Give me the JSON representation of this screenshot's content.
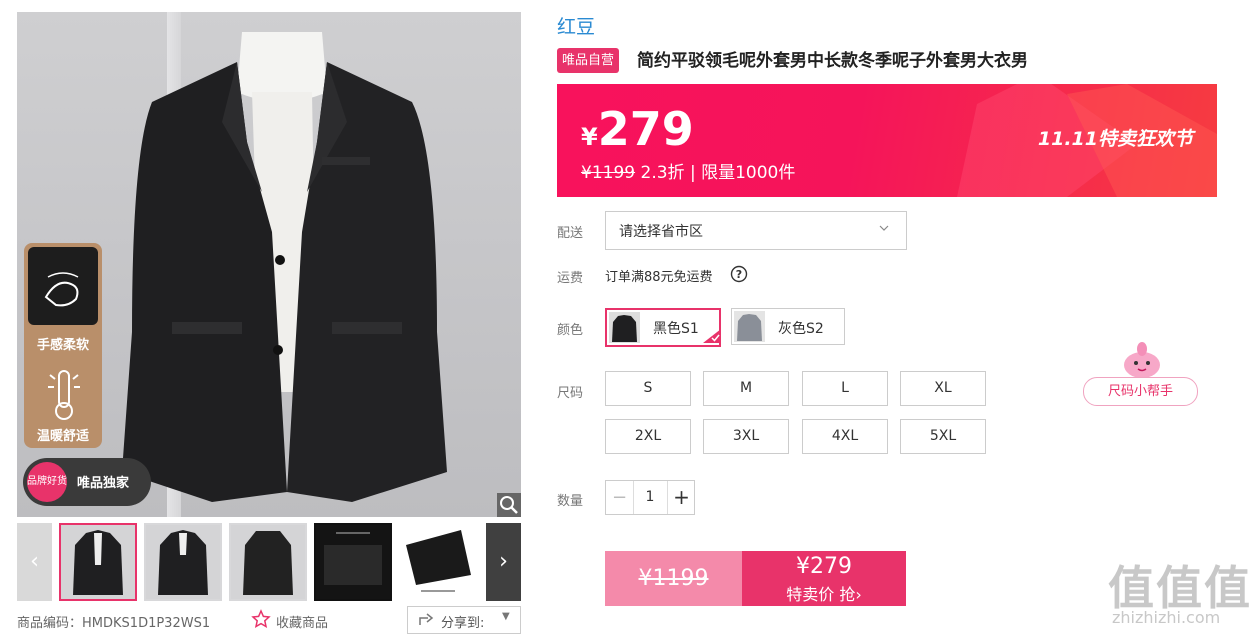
{
  "gallery": {
    "features": [
      "手感柔软",
      "温暖舒适"
    ],
    "brand_badge": {
      "circle_text": "品牌好货",
      "label": "唯品独家"
    },
    "thumb_count": 6
  },
  "product": {
    "brand": "红豆",
    "tag": "唯品自营",
    "title": "简约平驳领毛呢外套男中长款冬季呢子外套男大衣男",
    "price": {
      "currency": "¥",
      "amount": "279",
      "original": "¥1199",
      "discount": "2.3折",
      "separator": "|",
      "limit": "限量1000件",
      "promo": "11.11特卖狂欢节"
    },
    "delivery": {
      "label": "配送",
      "placeholder": "请选择省市区"
    },
    "shipping": {
      "label": "运费",
      "text": "订单满88元免运费"
    },
    "colors": {
      "label": "颜色",
      "options": [
        {
          "name": "黑色S1",
          "selected": true
        },
        {
          "name": "灰色S2",
          "selected": false
        }
      ]
    },
    "sizes": {
      "label": "尺码",
      "options": [
        "S",
        "M",
        "L",
        "XL",
        "2XL",
        "3XL",
        "4XL",
        "5XL"
      ],
      "helper": "尺码小帮手"
    },
    "quantity": {
      "label": "数量",
      "minus": "−",
      "value": "1",
      "plus": "+"
    },
    "buy": {
      "original": "¥1199",
      "price": "¥279",
      "action": "特卖价 抢",
      "chevron": "›"
    }
  },
  "meta": {
    "code_label": "商品编码：",
    "code": "HMDKS1D1P32WS1",
    "favorite": "收藏商品",
    "share": "分享到:"
  },
  "watermark": {
    "text": "值值值",
    "url": "zhizhizhi.com"
  },
  "colors": {
    "accent": "#e8336a",
    "link": "#2a8ad2",
    "banner": "#f8125c"
  }
}
